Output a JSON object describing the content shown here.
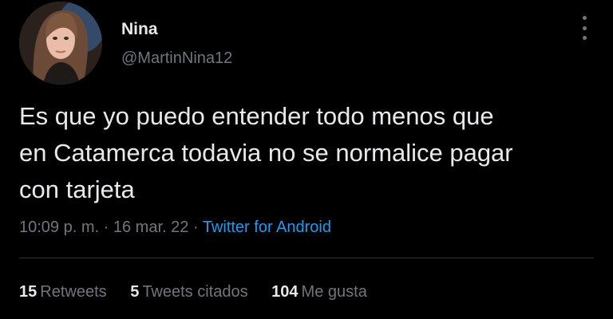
{
  "author": {
    "name": "Nina",
    "handle": "@MartinNina12"
  },
  "tweet": {
    "text": "Es que yo puedo entender todo menos que\nen Catamerca todavia no se normalice pagar\ncon tarjeta",
    "time": "10:09 p. m.",
    "separator": "·",
    "date": "16 mar. 22",
    "source": "Twitter for Android"
  },
  "stats": {
    "retweets_count": "15",
    "retweets_label": "Retweets",
    "quotes_count": "5",
    "quotes_label": "Tweets citados",
    "likes_count": "104",
    "likes_label": "Me gusta"
  },
  "icons": {
    "avatar": "profile-photo",
    "more": "more-vertical-icon"
  },
  "colors": {
    "background": "#000000",
    "text": "#e7e9ea",
    "secondary": "#71767b",
    "accent": "#1d9bf0",
    "divider": "#2f3336"
  }
}
